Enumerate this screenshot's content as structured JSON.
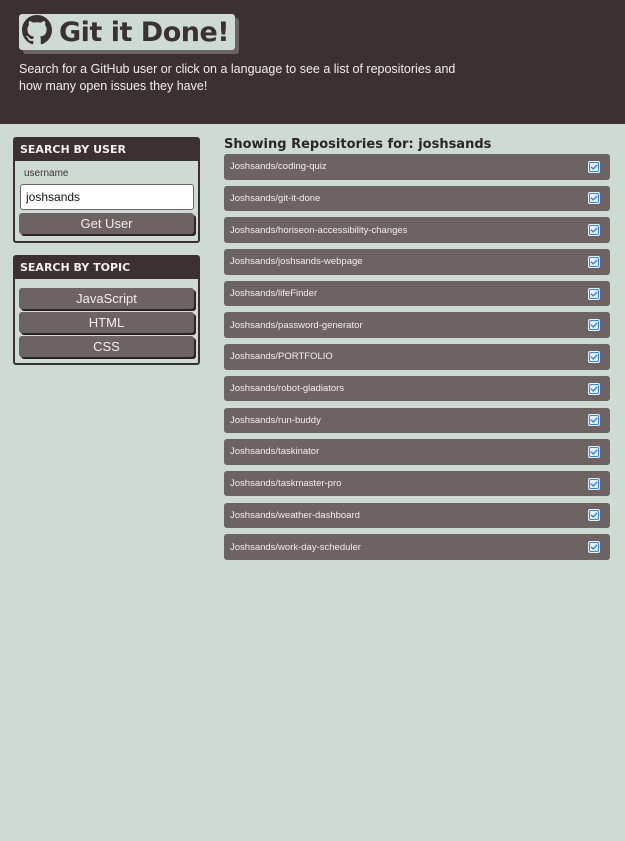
{
  "header": {
    "title": "Git it Done!",
    "subtitle": "Search for a GitHub user or click on a language to see a list of repositories and how many open issues they have!"
  },
  "user_search": {
    "heading": "SEARCH BY USER",
    "field_label": "username",
    "value": "joshsands",
    "button_label": "Get User"
  },
  "topic_search": {
    "heading": "SEARCH BY TOPIC",
    "topics": [
      "JavaScript",
      "HTML",
      "CSS"
    ]
  },
  "repos": {
    "heading_prefix": "Showing Repositories for: ",
    "search_term": "joshsands",
    "items": [
      {
        "name": "Joshsands/coding-quiz",
        "status_icon": "check-square-icon"
      },
      {
        "name": "Joshsands/git-it-done",
        "status_icon": "check-square-icon"
      },
      {
        "name": "Joshsands/horiseon-accessibility-changes",
        "status_icon": "check-square-icon"
      },
      {
        "name": "Joshsands/joshsands-webpage",
        "status_icon": "check-square-icon"
      },
      {
        "name": "Joshsands/lifeFinder",
        "status_icon": "check-square-icon"
      },
      {
        "name": "Joshsands/password-generator",
        "status_icon": "check-square-icon"
      },
      {
        "name": "Joshsands/PORTFOLIO",
        "status_icon": "check-square-icon"
      },
      {
        "name": "Joshsands/robot-gladiators",
        "status_icon": "check-square-icon"
      },
      {
        "name": "Joshsands/run-buddy",
        "status_icon": "check-square-icon"
      },
      {
        "name": "Joshsands/taskinator",
        "status_icon": "check-square-icon"
      },
      {
        "name": "Joshsands/taskmaster-pro",
        "status_icon": "check-square-icon"
      },
      {
        "name": "Joshsands/weather-dashboard",
        "status_icon": "check-square-icon"
      },
      {
        "name": "Joshsands/work-day-scheduler",
        "status_icon": "check-square-icon"
      }
    ]
  },
  "colors": {
    "background": "#cddbd3",
    "header_dark": "#3a3130",
    "item_gray": "#6d6362",
    "check_blue": "#2f81f7"
  }
}
